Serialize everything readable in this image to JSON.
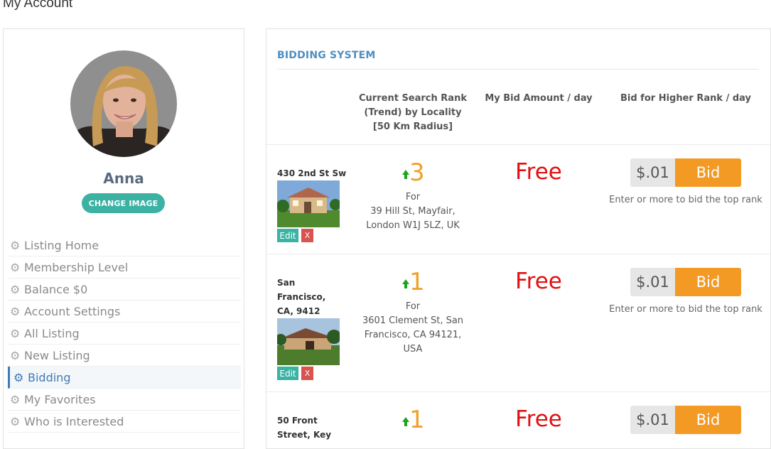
{
  "page": {
    "title": "My Account"
  },
  "profile": {
    "name": "Anna",
    "change_image_label": "CHANGE IMAGE"
  },
  "sidebar": {
    "items": [
      {
        "label": "Listing Home",
        "icon": "gear-icon"
      },
      {
        "label": "Membership Level",
        "icon": "gear-icon"
      },
      {
        "label": "Balance $0",
        "icon": "gear-icon"
      },
      {
        "label": "Account Settings",
        "icon": "gear-icon"
      },
      {
        "label": "All Listing",
        "icon": "gear-icon"
      },
      {
        "label": "New Listing",
        "icon": "gear-icon"
      },
      {
        "label": "Bidding",
        "icon": "gear-icon",
        "active": true
      },
      {
        "label": "My Favorites",
        "icon": "gear-icon"
      },
      {
        "label": "Who is Interested",
        "icon": "gear-icon"
      }
    ]
  },
  "bidding": {
    "title": "BIDDING SYSTEM",
    "columns": {
      "rank": "Current Search Rank (Trend) by Locality [50 Km Radius]",
      "my_bid": "My Bid Amount / day",
      "higher": "Bid for Higher Rank / day"
    },
    "rows": [
      {
        "address": "430 2nd St Sw",
        "rank": "3",
        "for_label": "For",
        "location": "39 Hill St, Mayfair, London W1J 5LZ, UK",
        "my_bid": "Free",
        "bid_value": "$.01",
        "bid_button": "Bid",
        "help": "Enter or more to bid the top rank",
        "edit_label": "Edit",
        "delete_label": "X"
      },
      {
        "address": "San Francisco, CA, 9412",
        "rank": "1",
        "for_label": "For",
        "location": "3601 Clement St, San Francisco, CA 94121, USA",
        "my_bid": "Free",
        "bid_value": "$.01",
        "bid_button": "Bid",
        "help": "Enter or more to bid the top rank",
        "edit_label": "Edit",
        "delete_label": "X"
      },
      {
        "address": "50 Front Street, Key",
        "rank": "1",
        "my_bid": "Free",
        "bid_value": "$.01",
        "bid_button": "Bid"
      }
    ]
  },
  "colors": {
    "accent_teal": "#3bb2a4",
    "title_blue": "#4f8fc0",
    "rank_orange": "#f0a12c",
    "free_red": "#e01010",
    "bid_orange": "#f39a25",
    "trend_green": "#1fa31f"
  }
}
